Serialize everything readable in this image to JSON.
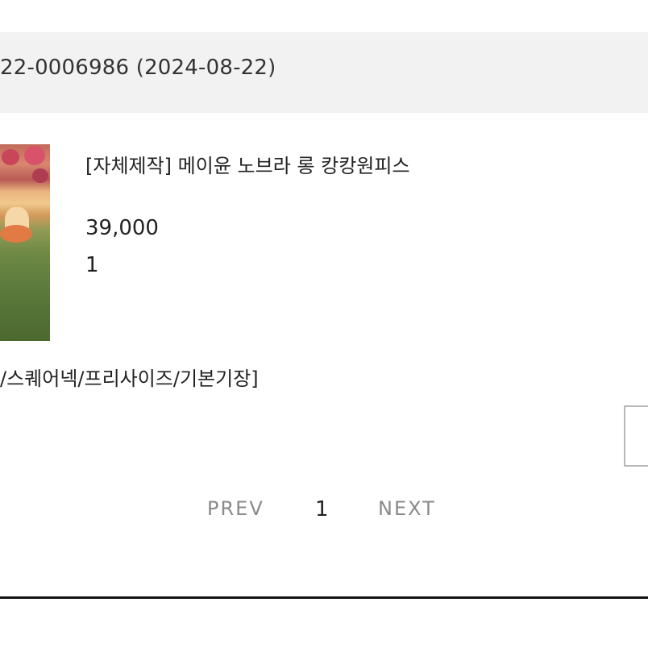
{
  "order": {
    "number_text": "22-0006986 (2024-08-22)"
  },
  "product": {
    "thumbnail": "product-photo",
    "name": "[자체제작] 메이윤 노브라 롱 캉캉원피스",
    "price": "39,000",
    "quantity": "1",
    "option": "/스퀘어넥/프리사이즈/기본기장]"
  },
  "pagination": {
    "prev_label": "PREV",
    "current_page": "1",
    "next_label": "NEXT"
  }
}
